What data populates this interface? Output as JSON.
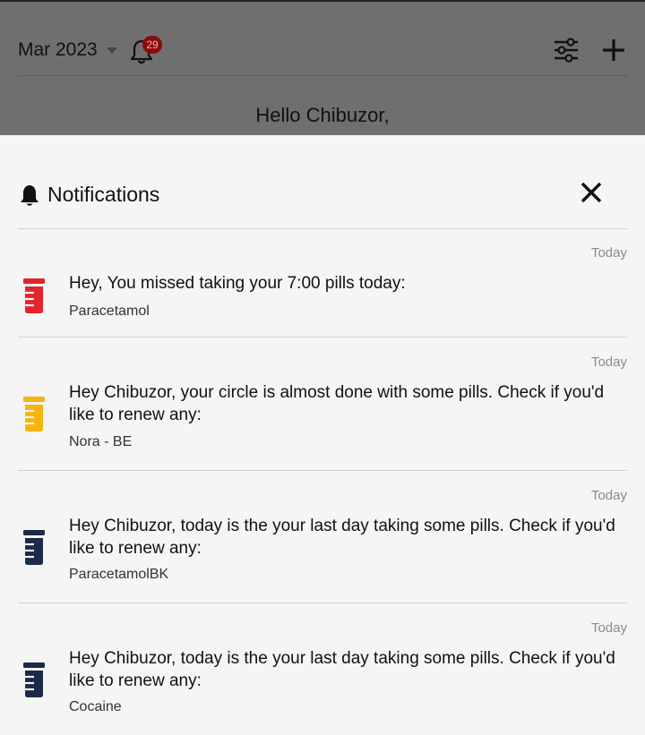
{
  "header": {
    "month": "Mar 2023",
    "notification_count": "29",
    "greeting": "Hello Chibuzor,"
  },
  "notifications_panel": {
    "title": "Notifications",
    "items": [
      {
        "time": "Today",
        "message": "Hey, You missed taking your 7:00 pills today:",
        "detail": "Paracetamol",
        "icon": "pill-bottle-icon",
        "icon_color": "#e5232a"
      },
      {
        "time": "Today",
        "message": "Hey Chibuzor, your circle is almost done with some pills. Check if you'd like to renew any:",
        "detail": "Nora - BE",
        "icon": "pill-bottle-icon",
        "icon_color": "#f6b40f"
      },
      {
        "time": "Today",
        "message": "Hey Chibuzor, today is the your last day taking some pills. Check if you'd like to renew any:",
        "detail": "ParacetamolBK",
        "icon": "pill-bottle-icon",
        "icon_color": "#1c2b4a"
      },
      {
        "time": "Today",
        "message": "Hey Chibuzor, today is the your last day taking some pills. Check if you'd like to renew any:",
        "detail": "Cocaine",
        "icon": "pill-bottle-icon",
        "icon_color": "#1c2b4a"
      }
    ]
  }
}
